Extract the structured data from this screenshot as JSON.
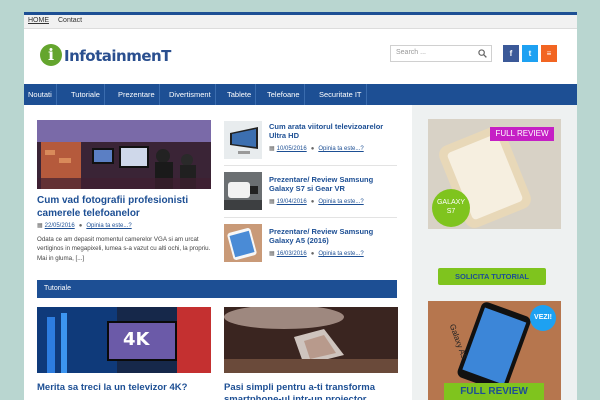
{
  "topbar": {
    "home": "HOME",
    "contact": "Contact"
  },
  "logo": {
    "letter": "i",
    "text": "InfotainmenT"
  },
  "search": {
    "placeholder": "Search ..."
  },
  "social": {
    "facebook": "f",
    "twitter": "t",
    "rss": "≡"
  },
  "nav": [
    "Noutati",
    "Tutoriale",
    "Prezentare",
    "Divertisment",
    "Tablete",
    "Telefoane",
    "Securitate IT"
  ],
  "featured": {
    "title": "Cum vad fotografii profesionisti camerele telefoanelor",
    "date": "22/05/2016",
    "comments": "Opinia ta este...?",
    "excerpt": "Odata ce am depasit momentul camerelor VGA si am urcat vertiginos in megapixeli, lumea s-a vazut cu alti ochi, la propriu. Mai in gluma, [...]"
  },
  "side_posts": [
    {
      "title": "Cum arata viitorul televizoarelor Ultra HD",
      "date": "10/05/2016",
      "comments": "Opinia ta este...?"
    },
    {
      "title": "Prezentare/ Review Samsung Galaxy S7 si Gear VR",
      "date": "19/04/2016",
      "comments": "Opinia ta este...?"
    },
    {
      "title": "Prezentare/ Review Samsung Galaxy A5 (2016)",
      "date": "16/03/2016",
      "comments": "Opinia ta este...?"
    }
  ],
  "section": {
    "label": "Tutoriale"
  },
  "bottom_posts": [
    {
      "title": "Merita sa treci la un televizor 4K?",
      "badge": "4K"
    },
    {
      "title": "Pasi simpli pentru a-ti transforma smartphone-ul intr-un proiector"
    }
  ],
  "sidebar": {
    "review1": {
      "badge": "FULL REVIEW",
      "circle": "GALAXY S7"
    },
    "button": "SOLICITA TUTORIAL",
    "review2": {
      "badge": "VEZI!",
      "model": "Galaxy A5",
      "banner": "FULL REVIEW"
    }
  },
  "colors": {
    "brand_blue": "#1d4f94",
    "green": "#7fc41e",
    "magenta": "#c51fc5"
  }
}
